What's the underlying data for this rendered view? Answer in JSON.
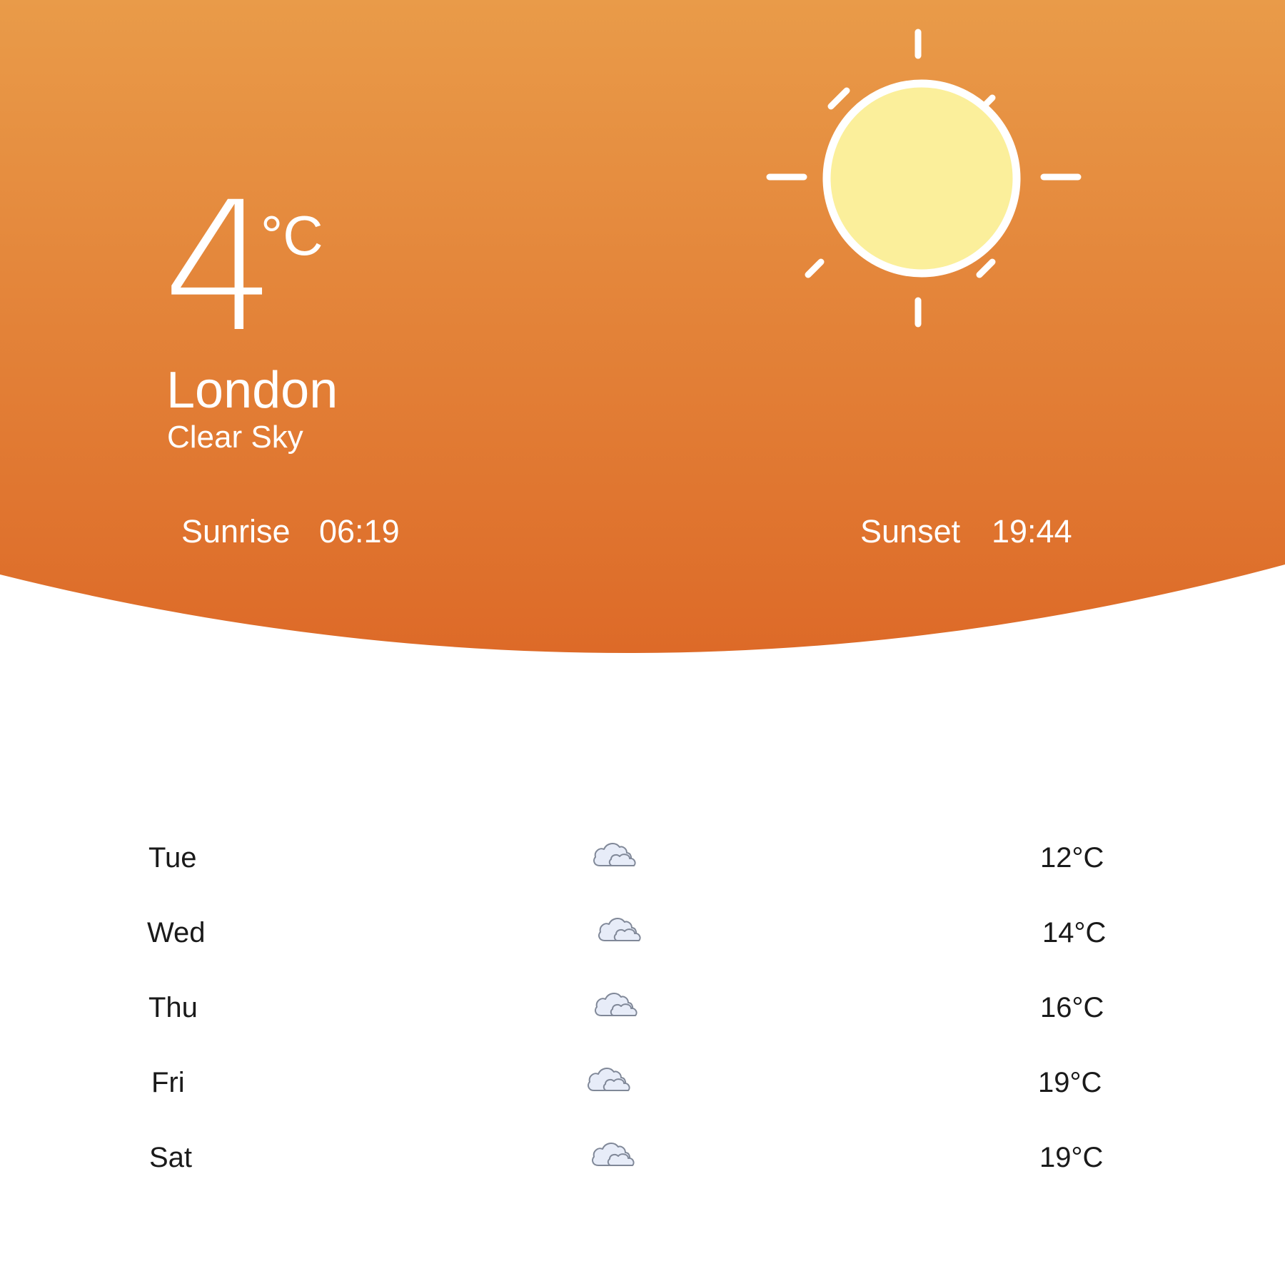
{
  "current": {
    "temperature": "4",
    "unit": "°C",
    "city": "London",
    "condition": "Clear Sky",
    "icon": "sun-icon"
  },
  "sun_times": {
    "sunrise_label": "Sunrise",
    "sunrise_time": "06:19",
    "sunset_label": "Sunset",
    "sunset_time": "19:44"
  },
  "forecast": [
    {
      "day": "Tue",
      "icon": "cloud-icon",
      "temp": "12°C"
    },
    {
      "day": "Wed",
      "icon": "cloud-icon",
      "temp": "14°C"
    },
    {
      "day": "Thu",
      "icon": "cloud-icon",
      "temp": "16°C"
    },
    {
      "day": "Fri",
      "icon": "cloud-icon",
      "temp": "19°C"
    },
    {
      "day": "Sat",
      "icon": "cloud-icon",
      "temp": "19°C"
    }
  ],
  "colors": {
    "header_top": "#E99B49",
    "header_bottom": "#DD6A28",
    "sun_fill": "#FBEF9B",
    "sun_stroke": "#FFFFFF",
    "cloud_fill": "#E7ECF8",
    "cloud_stroke": "#808898"
  }
}
